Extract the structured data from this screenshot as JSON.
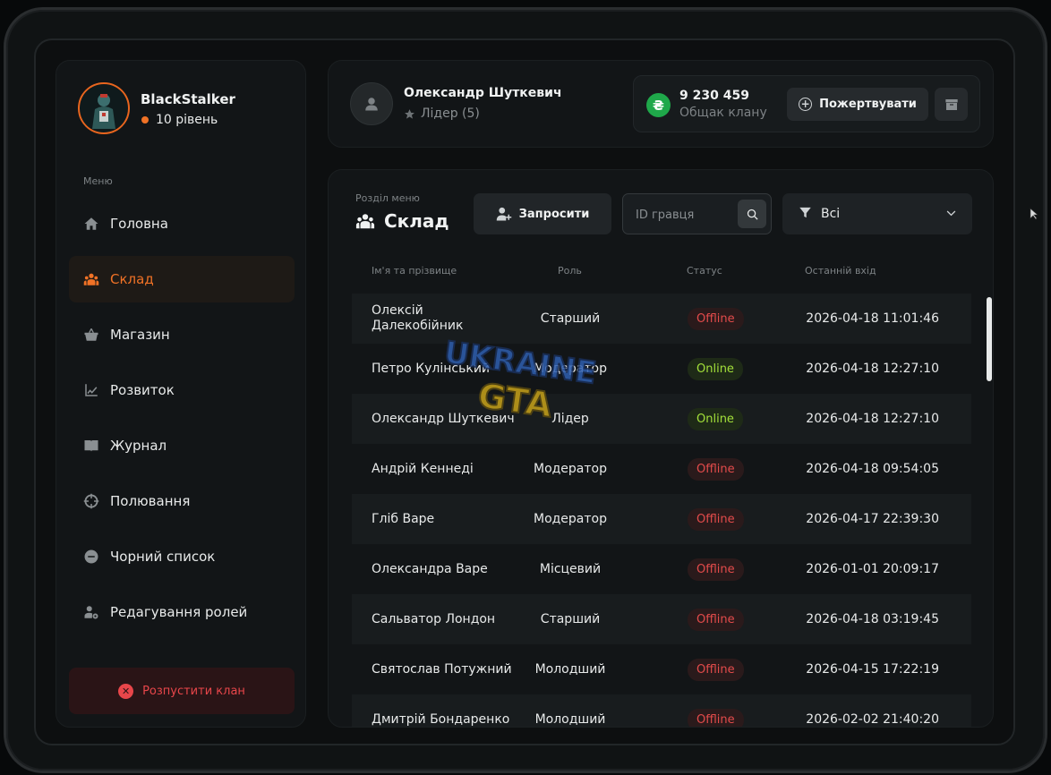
{
  "profile": {
    "name": "BlackStalker",
    "level": "10 рівень",
    "accent_color": "#f07226"
  },
  "sidebar": {
    "caption": "Меню",
    "items": [
      {
        "label": "Головна",
        "icon": "home-icon",
        "active": false
      },
      {
        "label": "Склад",
        "icon": "users-icon",
        "active": true
      },
      {
        "label": "Магазин",
        "icon": "basket-icon",
        "active": false
      },
      {
        "label": "Розвиток",
        "icon": "chart-icon",
        "active": false
      },
      {
        "label": "Журнал",
        "icon": "book-icon",
        "active": false
      },
      {
        "label": "Полювання",
        "icon": "crosshair-icon",
        "active": false
      },
      {
        "label": "Чорний список",
        "icon": "minus-circle-icon",
        "active": false
      },
      {
        "label": "Редагування ролей",
        "icon": "user-gear-icon",
        "active": false
      }
    ],
    "disband_label": "Розпустити клан"
  },
  "leader": {
    "name": "Олександр Шуткевич",
    "role": "Лідер (5)"
  },
  "bank": {
    "amount": "9 230 459",
    "caption": "Общак клану",
    "currency_color": "#1fa84a",
    "donate_label": "Пожертвувати"
  },
  "section": {
    "caption": "Розділ меню",
    "title": "Склад",
    "invite_label": "Запросити",
    "search_placeholder": "ID гравця",
    "filter_value": "Всі"
  },
  "table": {
    "headers": {
      "name": "Ім'я та прізвище",
      "role": "Роль",
      "status": "Статус",
      "last_login": "Останній вхід"
    },
    "rows": [
      {
        "name": "Олексій Далекобійник",
        "role": "Старший",
        "status": "Offline",
        "last_login": "2026-04-18 11:01:46"
      },
      {
        "name": "Петро Кулінський",
        "role": "Модератор",
        "status": "Online",
        "last_login": "2026-04-18 12:27:10"
      },
      {
        "name": "Олександр Шуткевич",
        "role": "Лідер",
        "status": "Online",
        "last_login": "2026-04-18 12:27:10"
      },
      {
        "name": "Андрій Кеннеді",
        "role": "Модератор",
        "status": "Offline",
        "last_login": "2026-04-18 09:54:05"
      },
      {
        "name": "Гліб Варе",
        "role": "Модератор",
        "status": "Offline",
        "last_login": "2026-04-17 22:39:30"
      },
      {
        "name": "Олександра Варе",
        "role": "Місцевий",
        "status": "Offline",
        "last_login": "2026-01-01 20:09:17"
      },
      {
        "name": "Сальватор Лондон",
        "role": "Старший",
        "status": "Offline",
        "last_login": "2026-04-18 03:19:45"
      },
      {
        "name": "Святослав Потужний",
        "role": "Молодший",
        "status": "Offline",
        "last_login": "2026-04-15 17:22:19"
      },
      {
        "name": "Дмитрій Бондаренко",
        "role": "Молодший",
        "status": "Offline",
        "last_login": "2026-02-02 21:40:20"
      }
    ]
  },
  "status_colors": {
    "online": "#a3e13a",
    "offline": "#e34b4b"
  }
}
